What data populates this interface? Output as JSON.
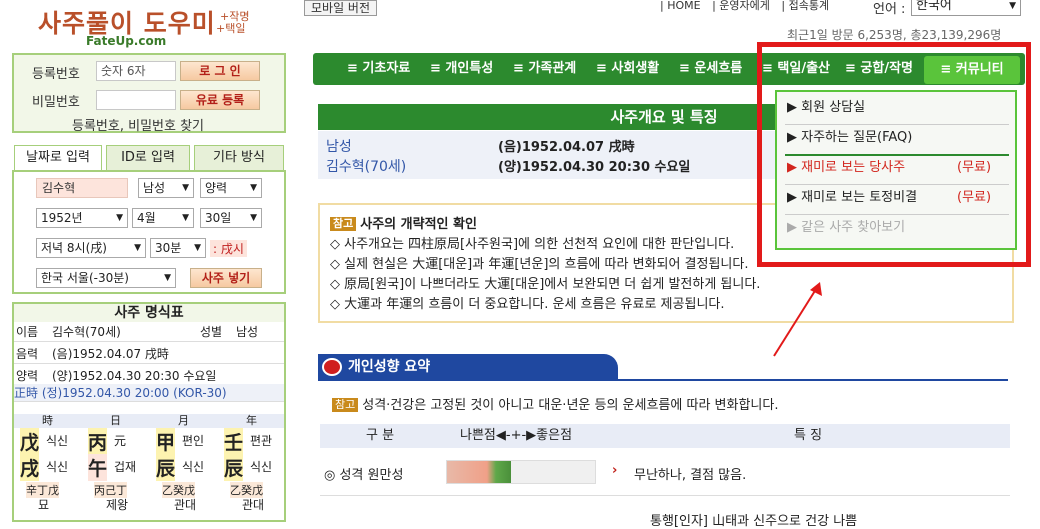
{
  "logo": {
    "main": "사주풀이 도우미",
    "side1": "+작명",
    "side2": "+택일",
    "url": "FateUp.com"
  },
  "header": {
    "mobile": "모바일 버전",
    "links": [
      "| HOME",
      "| 운영자에게",
      "| 접속통계"
    ],
    "lang_label": "언어 :",
    "lang_value": "한국어",
    "visits": "최근1일 방문 6,253명, 총23,139,296명"
  },
  "login": {
    "id_label": "등록번호",
    "id_placeholder": "숫자 6자",
    "login_btn": "로 그 인",
    "pw_label": "비밀번호",
    "paid_btn": "유료 등록",
    "find_link": "등록번호, 비밀번호 찾기"
  },
  "input_tabs": [
    "날짜로 입력",
    "ID로 입력",
    "기타 방식"
  ],
  "form": {
    "name": "김수혁",
    "gender": "남성",
    "calendar": "양력",
    "year": "1952년",
    "month": "4월",
    "day": "30일",
    "hour": "저녁 8시(戌)",
    "minute": "30분",
    "minute_label": ": 戌시",
    "location": "한국 서울(-30분)",
    "submit": "사주 넣기"
  },
  "pyo": {
    "title": "사주 명식표",
    "name_label": "이름",
    "name_val": "김수혁(70세)",
    "gender_label": "성별",
    "gender_val": "남성",
    "eum_label": "음력",
    "eum_val": "(음)1952.04.07 戌時",
    "yang_label": "양력",
    "yang_val": "(양)1952.04.30 20:30 수요일",
    "jungsi": "正時 (정)1952.04.30 20:00 (KOR-30)",
    "pillars": [
      {
        "head": "時",
        "top": "戊",
        "top_sub": "식신",
        "bot": "戌",
        "bot_sub": "식신",
        "jj": "辛丁戊",
        "un": "묘"
      },
      {
        "head": "日",
        "top": "丙",
        "top_sub": "元",
        "bot": "午",
        "bot_sub": "겁재",
        "jj": "丙己丁",
        "un": "제왕"
      },
      {
        "head": "月",
        "top": "甲",
        "top_sub": "편인",
        "bot": "辰",
        "bot_sub": "식신",
        "jj": "乙癸戊",
        "un": "관대"
      },
      {
        "head": "年",
        "top": "壬",
        "top_sub": "편관",
        "bot": "辰",
        "bot_sub": "식신",
        "jj": "乙癸戊",
        "un": "관대"
      }
    ]
  },
  "nav": {
    "items": [
      "≡ 기초자료",
      "≡ 개인특성",
      "≡ 가족관계",
      "≡ 사회생활",
      "≡ 운세흐름",
      "≡ 택일/출산",
      "≡ 궁합/작명"
    ],
    "community": "≡ 커뮤니티"
  },
  "dropdown": {
    "items": [
      {
        "label": "회원 상담실",
        "free": ""
      },
      {
        "label": "자주하는 질문(FAQ)",
        "free": ""
      },
      {
        "label": "재미로 보는 당사주",
        "free": "(무료)"
      },
      {
        "label": "재미로 보는 토정비결",
        "free": "(무료)"
      },
      {
        "label": "같은 사주 찾아보기",
        "free": ""
      }
    ]
  },
  "main": {
    "title": "사주개요 및 특징",
    "gender": "남성",
    "name": "김수혁(70세)",
    "eum": "(음)1952.04.07 戌時",
    "yang": "(양)1952.04.30 20:30 수요일",
    "notice_badge": "참고",
    "notice_title": "사주의 개략적인 확인",
    "notice_lines": [
      "◇ 사주개요는 四柱原局[사주원국]에 의한 선천적 요인에 대한 판단입니다.",
      "◇ 실제 현실은 大運[대운]과 年運[년운]의 흐름에 따라 변화되어 결정됩니다.",
      "◇ 原局[원국]이 나쁘더라도 大運[대운]에서 보완되면 더 쉽게 발전하게 됩니다.",
      "◇ 大運과 年運의 흐름이 더 중요합니다. 운세 흐름은 유료로 제공됩니다."
    ],
    "sec2_title": "개인성향 요약",
    "sec2_badge": "참고",
    "sec2_note": "성격·건강은 고정된 것이 아니고 대운·년운 등의 운세흐름에 따라 변화합니다.",
    "col1": "구 분",
    "col2": "나쁜점◀-+-▶좋은점",
    "col3": "특 징",
    "row1_label": "◎ 성격 원만성",
    "row1_level": 0.6,
    "row1_text": "무난하나, 결점 많음.",
    "row2_text": "통행[인자] 山태과 신주으로 건강 나쁨"
  },
  "colors": {
    "nav_green": "#2c8a2e",
    "community_green": "#5ac43b",
    "highlight_red": "#e21a1a",
    "section_blue": "#1f48a0"
  }
}
